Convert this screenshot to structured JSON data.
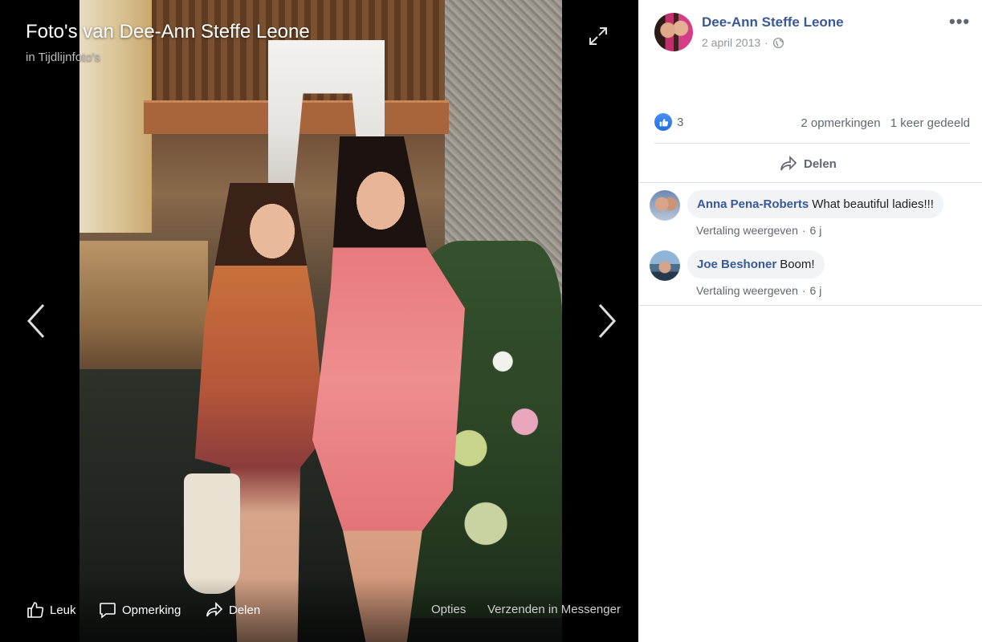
{
  "viewer": {
    "title": "Foto's van Dee-Ann Steffe Leone",
    "subtitle": "in Tijdlijnfoto's",
    "actions": {
      "like": "Leuk",
      "comment": "Opmerking",
      "share": "Delen",
      "options": "Opties",
      "messenger": "Verzenden in Messenger"
    },
    "icons": [
      "expand-icon",
      "chevron-left-icon",
      "chevron-right-icon",
      "thumbs-up-icon",
      "comment-icon",
      "share-icon"
    ]
  },
  "post": {
    "author": "Dee-Ann Steffe Leone",
    "date": "2 april 2013",
    "date_separator": "·",
    "more_label": "•••",
    "reactions_count": "3",
    "comments_count": "2 opmerkingen",
    "shares_count": "1 keer gedeeld",
    "share_button": "Delen"
  },
  "comments": [
    {
      "author": "Anna Pena-Roberts",
      "text": "What beautiful ladies!!!",
      "translate": "Vertaling weergeven",
      "separator": "·",
      "time": "6 j"
    },
    {
      "author": "Joe Beshoner",
      "text": "Boom!",
      "translate": "Vertaling weergeven",
      "separator": "·",
      "time": "6 j"
    }
  ],
  "colors": {
    "link": "#385898",
    "like_blue": "#1877f2",
    "bubble": "#f2f3f5",
    "meta": "#606770"
  }
}
